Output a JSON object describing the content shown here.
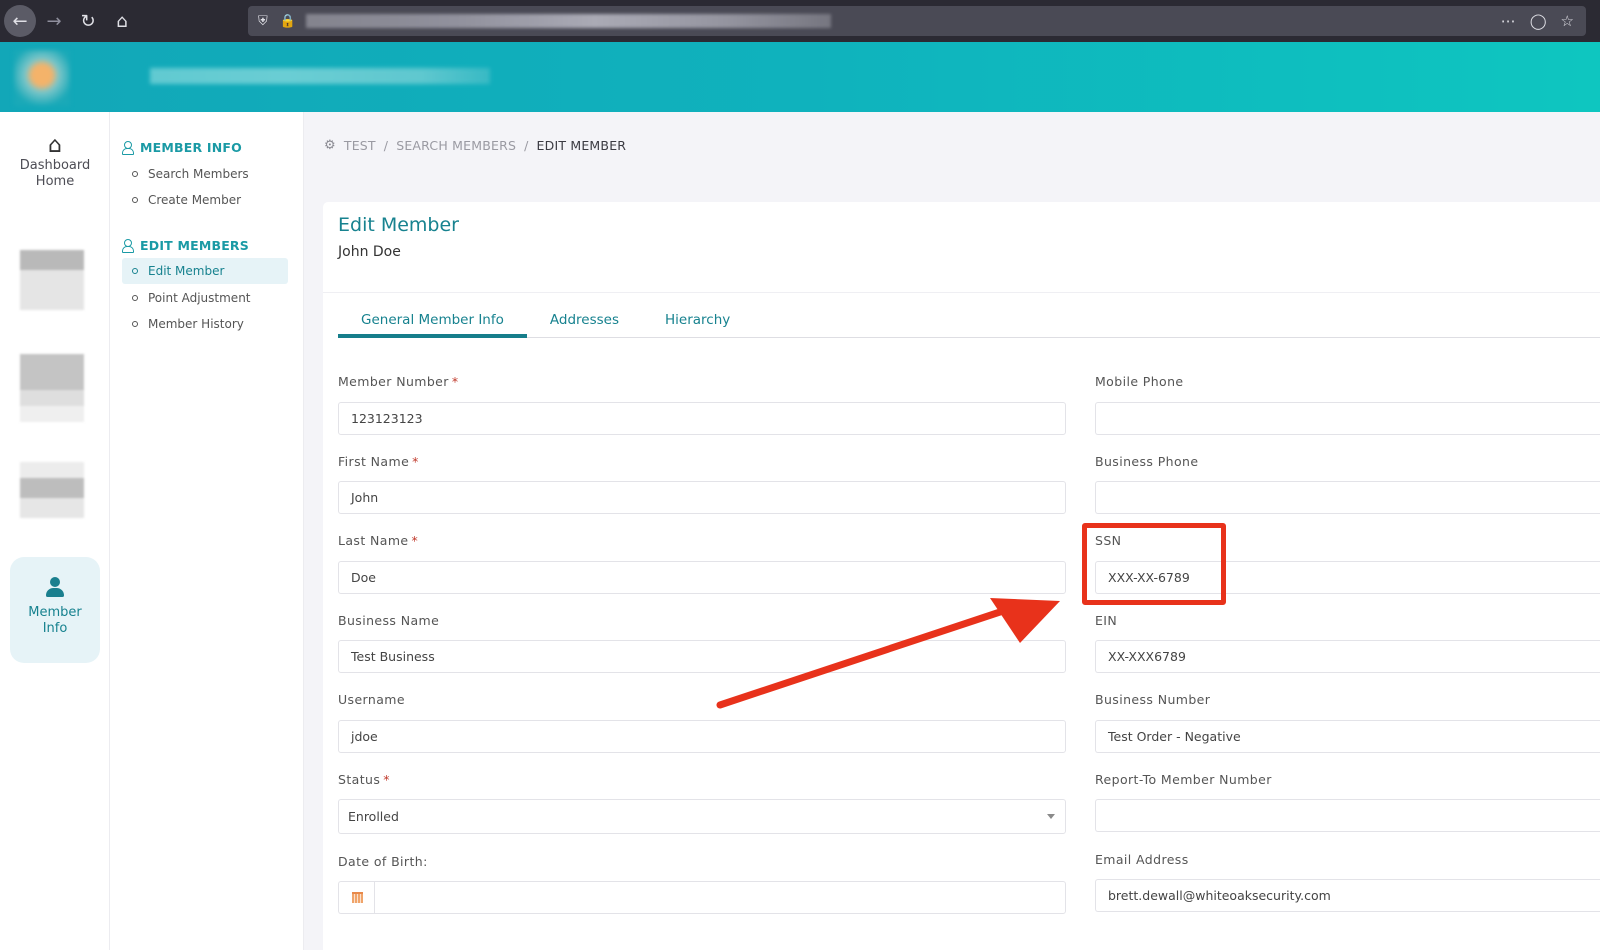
{
  "browser": {
    "nav_icons": [
      "back-arrow-icon",
      "forward-arrow-icon",
      "reload-icon",
      "home-icon"
    ],
    "url_blurred": true,
    "actions": [
      "more-icon",
      "pocket-icon",
      "bookmark-star-icon"
    ]
  },
  "app_header": {
    "logo_blurred": true,
    "brand_blurred": true,
    "color": "#12a7b8"
  },
  "rail": {
    "items": [
      {
        "label_line1": "Dashboard",
        "label_line2": "Home",
        "icon": "home-icon"
      },
      {
        "blurred": true
      },
      {
        "blurred": true
      },
      {
        "blurred": true
      },
      {
        "label_line1": "Member",
        "label_line2": "Info",
        "icon": "user-icon",
        "active": true
      }
    ]
  },
  "subnav": {
    "sections": [
      {
        "title": "MEMBER INFO",
        "items": [
          "Search Members",
          "Create Member"
        ]
      },
      {
        "title": "EDIT MEMBERS",
        "items": [
          "Edit Member",
          "Point Adjustment",
          "Member History"
        ],
        "active": "Edit Member"
      }
    ]
  },
  "breadcrumb": {
    "items": [
      "TEST",
      "SEARCH MEMBERS",
      "EDIT MEMBER"
    ],
    "separator": "/"
  },
  "card": {
    "title": "Edit Member",
    "subtitle": "John Doe",
    "tabs": [
      "General Member Info",
      "Addresses",
      "Hierarchy"
    ],
    "active_tab": "General Member Info"
  },
  "form": {
    "left": [
      {
        "label": "Member Number",
        "required": true,
        "value": "123123123"
      },
      {
        "label": "First Name",
        "required": true,
        "value": "John"
      },
      {
        "label": "Last Name",
        "required": true,
        "value": "Doe"
      },
      {
        "label": "Business Name",
        "required": false,
        "value": "Test Business"
      },
      {
        "label": "Username",
        "required": false,
        "value": "jdoe"
      },
      {
        "label": "Status",
        "required": true,
        "value": "Enrolled",
        "type": "select"
      },
      {
        "label": "Date of Birth:",
        "required": false,
        "value": "",
        "type": "date"
      }
    ],
    "right": [
      {
        "label": "Mobile Phone",
        "value": ""
      },
      {
        "label": "Business Phone",
        "value": ""
      },
      {
        "label": "SSN",
        "value": "XXX-XX-6789",
        "highlighted": true
      },
      {
        "label": "EIN",
        "value": "XX-XXX6789"
      },
      {
        "label": "Business Number",
        "value": "Test Order - Negative"
      },
      {
        "label": "Report-To Member Number",
        "value": ""
      },
      {
        "label": "Email Address",
        "value": "brett.dewall@whiteoaksecurity.com"
      }
    ],
    "required_marker": "*"
  },
  "annotation": {
    "color": "#e8321b",
    "target": "SSN"
  }
}
